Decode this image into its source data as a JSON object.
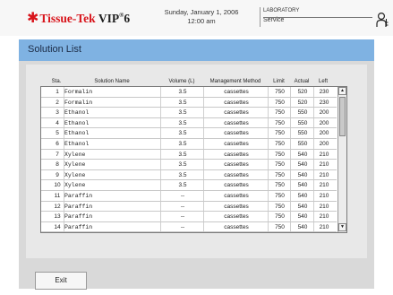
{
  "header": {
    "logo_brand": "Tissue-Tek",
    "logo_model": "VIP",
    "logo_reg": "®",
    "logo_version": "6",
    "date": "Sunday, January 1, 2006",
    "time": "12:00 am",
    "location": "LABORATORY",
    "location_mode": "Service"
  },
  "page": {
    "title": "Solution List"
  },
  "table": {
    "columns": [
      "Sta.",
      "Solution Name",
      "Volume (L)",
      "Management Method",
      "Limit",
      "Actual",
      "Left"
    ],
    "rows": [
      {
        "sta": "1",
        "name": "Formalin",
        "vol": "3.5",
        "mgmt": "cassettes",
        "limit": "750",
        "actual": "520",
        "left": "230"
      },
      {
        "sta": "2",
        "name": "Formalin",
        "vol": "3.5",
        "mgmt": "cassettes",
        "limit": "750",
        "actual": "520",
        "left": "230"
      },
      {
        "sta": "3",
        "name": "Ethanol",
        "vol": "3.5",
        "mgmt": "cassettes",
        "limit": "750",
        "actual": "550",
        "left": "200"
      },
      {
        "sta": "4",
        "name": "Ethanol",
        "vol": "3.5",
        "mgmt": "cassettes",
        "limit": "750",
        "actual": "550",
        "left": "200"
      },
      {
        "sta": "5",
        "name": "Ethanol",
        "vol": "3.5",
        "mgmt": "cassettes",
        "limit": "750",
        "actual": "550",
        "left": "200"
      },
      {
        "sta": "6",
        "name": "Ethanol",
        "vol": "3.5",
        "mgmt": "cassettes",
        "limit": "750",
        "actual": "550",
        "left": "200"
      },
      {
        "sta": "7",
        "name": "Xylene",
        "vol": "3.5",
        "mgmt": "cassettes",
        "limit": "750",
        "actual": "540",
        "left": "210"
      },
      {
        "sta": "8",
        "name": "Xylene",
        "vol": "3.5",
        "mgmt": "cassettes",
        "limit": "750",
        "actual": "540",
        "left": "210"
      },
      {
        "sta": "9",
        "name": "Xylene",
        "vol": "3.5",
        "mgmt": "cassettes",
        "limit": "750",
        "actual": "540",
        "left": "210"
      },
      {
        "sta": "10",
        "name": "Xylene",
        "vol": "3.5",
        "mgmt": "cassettes",
        "limit": "750",
        "actual": "540",
        "left": "210"
      },
      {
        "sta": "11",
        "name": "Paraffin",
        "vol": "--",
        "mgmt": "cassettes",
        "limit": "750",
        "actual": "540",
        "left": "210"
      },
      {
        "sta": "12",
        "name": "Paraffin",
        "vol": "--",
        "mgmt": "cassettes",
        "limit": "750",
        "actual": "540",
        "left": "210"
      },
      {
        "sta": "13",
        "name": "Paraffin",
        "vol": "--",
        "mgmt": "cassettes",
        "limit": "750",
        "actual": "540",
        "left": "210"
      },
      {
        "sta": "14",
        "name": "Paraffin",
        "vol": "--",
        "mgmt": "cassettes",
        "limit": "750",
        "actual": "540",
        "left": "210"
      }
    ]
  },
  "footer": {
    "exit_label": "Exit"
  },
  "colors": {
    "brand_red": "#d8141b",
    "titlebar_blue": "#7fb2e2",
    "panel_gray": "#d9d9d9"
  },
  "icons": {
    "logo": "star-icon",
    "user": "user-key-icon",
    "scroll_up": "arrow-up-icon",
    "scroll_down": "arrow-down-icon"
  }
}
